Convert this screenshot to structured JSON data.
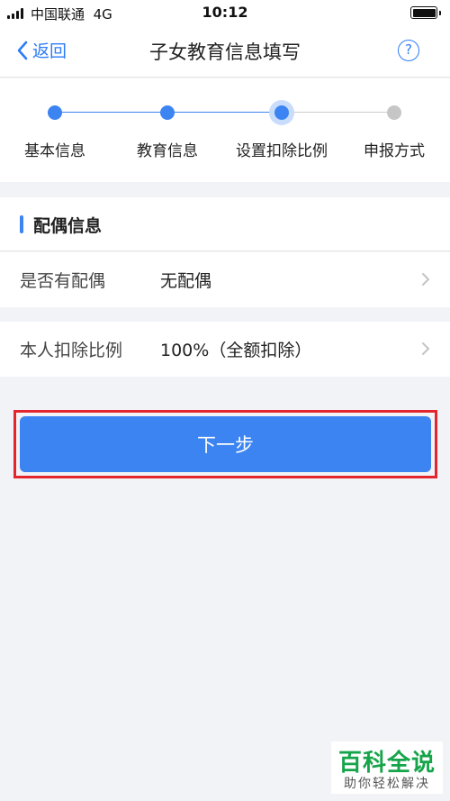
{
  "status_bar": {
    "carrier": "中国联通",
    "network": "4G",
    "time": "10:12"
  },
  "nav": {
    "back_label": "返回",
    "title": "子女教育信息填写",
    "help_symbol": "?"
  },
  "steps": [
    {
      "label": "基本信息",
      "state": "done"
    },
    {
      "label": "教育信息",
      "state": "done"
    },
    {
      "label": "设置扣除比例",
      "state": "current"
    },
    {
      "label": "申报方式",
      "state": "pending"
    }
  ],
  "spouse_section": {
    "title": "配偶信息",
    "has_spouse_label": "是否有配偶",
    "has_spouse_value": "无配偶"
  },
  "ratio_section": {
    "label": "本人扣除比例",
    "value": "100%（全额扣除）"
  },
  "next_button": {
    "label": "下一步"
  },
  "watermark": {
    "title": "百科全说",
    "subtitle": "助你轻松解决"
  },
  "colors": {
    "accent": "#3b84f2",
    "highlight_border": "#e3262d",
    "watermark_green": "#16a44a"
  }
}
